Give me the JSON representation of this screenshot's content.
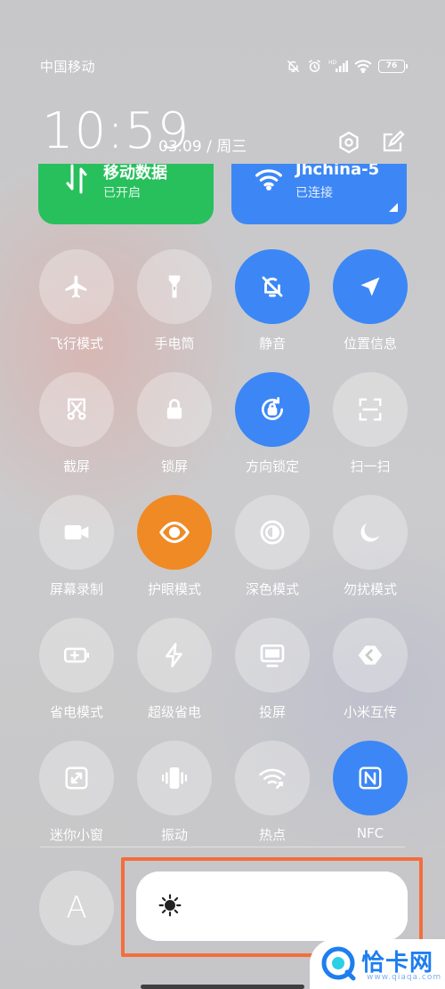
{
  "status_bar": {
    "carrier": "中国移动",
    "battery": "76",
    "icons": [
      "mute-bell-icon",
      "alarm-icon",
      "hd-signal-icon",
      "wifi-icon",
      "battery-icon"
    ]
  },
  "header": {
    "time": "10:59",
    "date": "03.09 / 周三",
    "settings_icon": "settings-icon",
    "edit_icon": "edit-icon"
  },
  "cards": {
    "mobile_data": {
      "title": "移动数据",
      "status": "已开启",
      "color": "#27c05d",
      "icon": "data-arrows-icon"
    },
    "wifi": {
      "title": "Jhchina-5",
      "status": "已连接",
      "color": "#3c87f5",
      "icon": "wifi-icon"
    }
  },
  "toggles": [
    {
      "label": "飞行模式",
      "icon": "airplane-icon",
      "active": false
    },
    {
      "label": "手电筒",
      "icon": "flashlight-icon",
      "active": false
    },
    {
      "label": "静音",
      "icon": "mute-bell-icon",
      "active": true
    },
    {
      "label": "位置信息",
      "icon": "location-arrow-icon",
      "active": true
    },
    {
      "label": "截屏",
      "icon": "screenshot-icon",
      "active": false
    },
    {
      "label": "锁屏",
      "icon": "lock-icon",
      "active": false
    },
    {
      "label": "方向锁定",
      "icon": "rotation-lock-icon",
      "active": true
    },
    {
      "label": "扫一扫",
      "icon": "scan-icon",
      "active": false
    },
    {
      "label": "屏幕录制",
      "icon": "video-camera-icon",
      "active": false
    },
    {
      "label": "护眼模式",
      "icon": "eye-icon",
      "active": true
    },
    {
      "label": "深色模式",
      "icon": "dark-mode-icon",
      "active": false
    },
    {
      "label": "勿扰模式",
      "icon": "moon-icon",
      "active": false
    },
    {
      "label": "省电模式",
      "icon": "battery-saver-icon",
      "active": false
    },
    {
      "label": "超级省电",
      "icon": "lightning-icon",
      "active": false
    },
    {
      "label": "投屏",
      "icon": "screen-cast-icon",
      "active": false
    },
    {
      "label": "小米互传",
      "icon": "share-transfer-icon",
      "active": false
    },
    {
      "label": "迷你小窗",
      "icon": "mini-window-icon",
      "active": false
    },
    {
      "label": "振动",
      "icon": "vibrate-icon",
      "active": false
    },
    {
      "label": "热点",
      "icon": "hotspot-icon",
      "active": false
    },
    {
      "label": "NFC",
      "icon": "nfc-icon",
      "active": true
    }
  ],
  "brightness": {
    "auto_label": "A",
    "icon": "sun-icon",
    "level": 1.0
  },
  "watermark": {
    "text": "恰卡网",
    "sub": "www.qiaqa.com"
  },
  "colors": {
    "active_blue": "#3c87f5",
    "eye_orange": "#f08a24",
    "mobile_green": "#27c05d",
    "highlight": "#f36e3c"
  }
}
